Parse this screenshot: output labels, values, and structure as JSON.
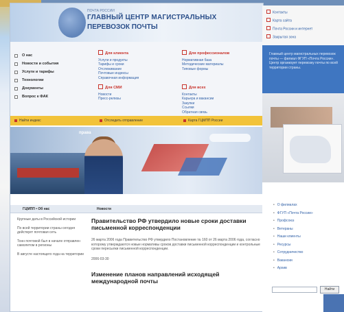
{
  "header": {
    "logo_subtitle": "ПОЧТА РОССИИ",
    "title_line1": "ГЛАВНЫЙ ЦЕНТР МАГИСТРАЛЬНЫХ",
    "title_line2": "ПЕРЕВОЗОК ПОЧТЫ"
  },
  "left_nav": [
    "О нас",
    "Новости и события",
    "Услуги и тарифы",
    "Технологии",
    "Документы",
    "Вопрос к ФАК"
  ],
  "columns": {
    "clients": {
      "head": "Для клиента",
      "links": [
        "Услуги и продукты",
        "Тарифы и сроки",
        "Отслеживание",
        "Почтовые индексы",
        "Справочная информация"
      ]
    },
    "smi": {
      "head": "Для СМИ",
      "links": [
        "Новости",
        "Пресс-релизы"
      ]
    },
    "pro": {
      "head": "Для профессионалов",
      "links": [
        "Нормативная база",
        "Методические материалы",
        "Типовые формы"
      ]
    },
    "all": {
      "head": "Для всех",
      "links": [
        "Контакты",
        "Карьера и вакансии",
        "Закупки",
        "Ссылки",
        "Обратная связь"
      ]
    }
  },
  "yellow_bar": [
    "Найти индекс",
    "Отследить отправление",
    "Карта ГЦМПП России"
  ],
  "hero": {
    "label": "права"
  },
  "tabs": {
    "left": "ГЦМПП • Об нас",
    "right": "Новости"
  },
  "left_column": [
    "Крупные даты в Российской истории",
    "По всей территории страны сегодня действует почтовая сеть",
    "Тонн почтовой был в начале отправлен самолетом в регионы",
    "В августе настоящего года на территории"
  ],
  "news": [
    {
      "title": "Правительство РФ утвердило новые сроки доставки письменной корреспонденции",
      "body": "26 марта 2006 года Правительство РФ утвердило Постановление № 160 от 26 марта 2006 года, согласно которому утверждаются новые нормативы сроков доставки письменной корреспонденции и контрольные сроки пересылки письменной корреспонденции.",
      "date": "2006-03-30"
    },
    {
      "title": "Изменение планов направлений исходящей международной почты",
      "body": "",
      "date": ""
    }
  ],
  "right_window": {
    "top_links": [
      "Контакты",
      "Карта сайта",
      "Почта России и интернет",
      "Закрытая зона"
    ],
    "blue_text": "Главный центр магистральных перевозок почты — филиал ФГУП «Почта России». Центр организует перевозку почты по всей территории страны.",
    "list": [
      "О филиалах",
      "ФГУП «Почта России»",
      "Профсоюз",
      "Ветераны",
      "Наши клиенты",
      "Ресурсы",
      "Сотрудничество",
      "Вакансии",
      "Архив"
    ],
    "search_button": "Найти"
  },
  "colors": {
    "accent": "#2b4f8a",
    "yellow": "#f2c33a",
    "red": "#c8322a",
    "blue": "#3f76c1"
  }
}
